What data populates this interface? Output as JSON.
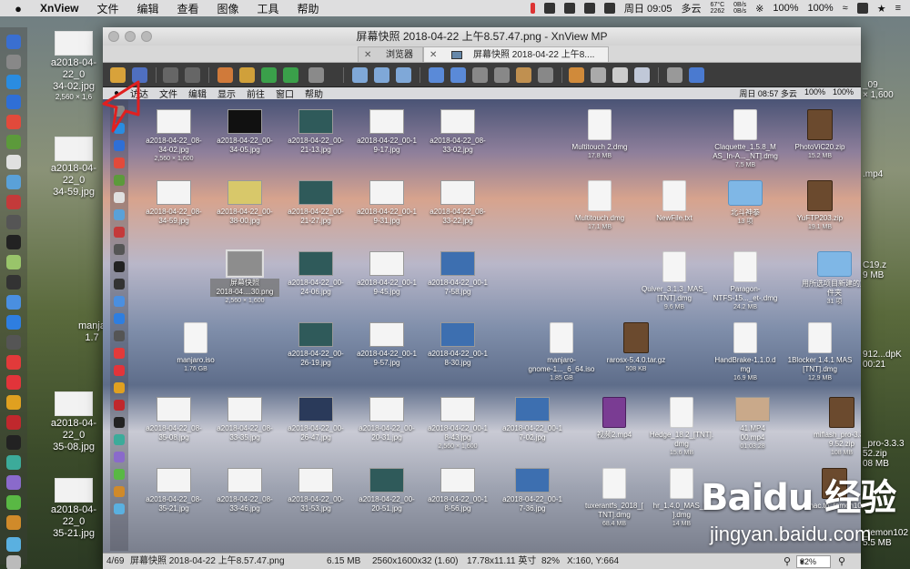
{
  "menubar": {
    "app_name": "XnView",
    "menus": [
      "文件",
      "编辑",
      "查看",
      "图像",
      "工具",
      "帮助"
    ],
    "status": {
      "temp": "67°C",
      "rpm": "2262",
      "net_up": "0B/s",
      "net_down": "0B/s",
      "clock": "周日 09:05",
      "weather": "多云",
      "battery": "100%",
      "battery2": "100%"
    }
  },
  "desktop": {
    "icons": [
      {
        "label": "a2018-04-22_0",
        "label2": "34-02.jpg",
        "sub": "2,560 × 1,6"
      },
      {
        "label": "a2018-04-22_0",
        "label2": "34-59.jpg",
        "sub": ""
      },
      {
        "label": "manja",
        "label2": "",
        "sub": "1.7"
      },
      {
        "label": "a2018-04-22_0",
        "label2": "35-08.jpg",
        "sub": ""
      },
      {
        "label": "a2018-04-22_0",
        "label2": "35-21.jpg",
        "sub": ""
      }
    ],
    "right_labels": [
      "_09_",
      "× 1,600",
      ".mp4",
      "C19.z",
      "9 MB",
      "912...dpK",
      "00:21",
      "_pro-3.3.3",
      "52.zip",
      "08 MB",
      "_temon102",
      "5.5 MB"
    ]
  },
  "window": {
    "title": "屏幕快照 2018-04-22 上午8.57.47.png - XnView MP",
    "tabs": [
      {
        "label": "浏览器"
      },
      {
        "label": "屏幕快照 2018-04-22 上午8...."
      }
    ]
  },
  "viewport": {
    "inner_menubar": {
      "menus": [
        "访达",
        "文件",
        "编辑",
        "显示",
        "前往",
        "窗口",
        "帮助"
      ],
      "status": "周日 08:57  多云",
      "battery": "100%",
      "battery2": "100%"
    },
    "files": [
      {
        "name": "a2018-04-22_08-",
        "name2": "34-02.jpg",
        "sub": "2,560 × 1,600",
        "kind": "img-white"
      },
      {
        "name": "a2018-04-22_00-",
        "name2": "34-05.jpg",
        "sub": "",
        "kind": "img-black"
      },
      {
        "name": "a2018-04-22_00-",
        "name2": "21-13.jpg",
        "sub": "",
        "kind": "img-teal"
      },
      {
        "name": "a2018-04-22_00-1",
        "name2": "9-17.jpg",
        "sub": "",
        "kind": "img-white"
      },
      {
        "name": "a2018-04-22_08-",
        "name2": "33-02.jpg",
        "sub": "",
        "kind": "img-white"
      },
      {
        "name": "Multitouch 2.dmg",
        "name2": "",
        "sub": "17.8 MB",
        "kind": "doc"
      },
      {
        "name": "Claquette_1.5.8_M",
        "name2": "AS_In-A..._NT].dmg",
        "sub": "7.5 MB",
        "kind": "doc"
      },
      {
        "name": "PhotoViC20.zip",
        "name2": "",
        "sub": "15.2 MB",
        "kind": "zip"
      },
      {
        "name": "a2018-04-22_08-",
        "name2": "34-59.jpg",
        "sub": "",
        "kind": "img-white"
      },
      {
        "name": "a2018-04-22_00-",
        "name2": "38-00.jpg",
        "sub": "",
        "kind": "img-yellow"
      },
      {
        "name": "a2018-04-22_00-",
        "name2": "21-27.jpg",
        "sub": "",
        "kind": "img-teal"
      },
      {
        "name": "a2018-04-22_00-1",
        "name2": "9-31.jpg",
        "sub": "",
        "kind": "img-white"
      },
      {
        "name": "a2018-04-22_08-",
        "name2": "33-22.jpg",
        "sub": "",
        "kind": "img-white"
      },
      {
        "name": "Multitouch.dmg",
        "name2": "",
        "sub": "17.1 MB",
        "kind": "doc"
      },
      {
        "name": "NewFile.txt",
        "name2": "",
        "sub": "",
        "kind": "doc"
      },
      {
        "name": "北斗神拳",
        "name2": "",
        "sub": "13 项",
        "kind": "folder"
      },
      {
        "name": "YuFTP203.zip",
        "name2": "",
        "sub": "19.1 MB",
        "kind": "zip"
      },
      {
        "name": "b.mp4",
        "name2": "",
        "sub": "",
        "kind": "mp4"
      },
      {
        "name": "屏幕快照",
        "name2": "2018-04....30.png",
        "sub": "2,560 × 1,600",
        "kind": "img-selected"
      },
      {
        "name": "a2018-04-22_00-",
        "name2": "24-06.jpg",
        "sub": "",
        "kind": "img-teal"
      },
      {
        "name": "a2018-04-22_00-1",
        "name2": "9-45.jpg",
        "sub": "",
        "kind": "img-white"
      },
      {
        "name": "a2018-04-22_00-1",
        "name2": "7-58.jpg",
        "sub": "",
        "kind": "img-blue"
      },
      {
        "name": "Quiver_3.1.3_MAS_",
        "name2": "[TNT].dmg",
        "sub": "9.6 MB",
        "kind": "doc"
      },
      {
        "name": "Paragon-",
        "name2": "NTFS-15..._et-.dmg",
        "sub": "24.2 MB",
        "kind": "doc"
      },
      {
        "name": "用所选项目新建的文",
        "name2": "件夹",
        "sub": "31 项",
        "kind": "folder"
      },
      {
        "name": "LauC19.zip",
        "name2": "",
        "sub": "9.9 MB",
        "kind": "zip"
      },
      {
        "name": "manjaro.iso",
        "name2": "",
        "sub": "1.76 GB",
        "kind": "doc"
      },
      {
        "name": "a2018-04-22_00-",
        "name2": "26-19.jpg",
        "sub": "",
        "kind": "img-teal"
      },
      {
        "name": "a2018-04-22_00-1",
        "name2": "9-57.jpg",
        "sub": "",
        "kind": "img-white"
      },
      {
        "name": "a2018-04-22_00-1",
        "name2": "8-30.jpg",
        "sub": "",
        "kind": "img-blue"
      },
      {
        "name": "manjaro-",
        "name2": "gnome-1..._6_64.iso",
        "sub": "1.85 GB",
        "kind": "doc"
      },
      {
        "name": "rarosx-5.4.0.tar.gz",
        "name2": "",
        "sub": "508 KB",
        "kind": "zip"
      },
      {
        "name": "HandBrake-1.1.0.d",
        "name2": "mg",
        "sub": "16.9 MB",
        "kind": "doc"
      },
      {
        "name": "1Blocker 1.4.1 MAS",
        "name2": "[TNT].dmg",
        "sub": "12.9 MB",
        "kind": "doc"
      },
      {
        "name": "x2M...PII912...dpK",
        "name2": "",
        "sub": "00:21",
        "kind": "zip"
      },
      {
        "name": "a2018-04-22_08-",
        "name2": "35-08.jpg",
        "sub": "",
        "kind": "img-white"
      },
      {
        "name": "a2018-04-22_08-",
        "name2": "33-35.jpg",
        "sub": "",
        "kind": "img-white"
      },
      {
        "name": "a2018-04-22_00-",
        "name2": "26-47.jpg",
        "sub": "",
        "kind": "img-dark"
      },
      {
        "name": "a2018-04-22_00-",
        "name2": "20-31.jpg",
        "sub": "",
        "kind": "img-white"
      },
      {
        "name": "a2018-04-22_00-1",
        "name2": "8-43.jpg",
        "sub": "2,560 × 1,600",
        "kind": "img-white"
      },
      {
        "name": "a2018-04-22_00-1",
        "name2": "7-02.jpg",
        "sub": "",
        "kind": "img-blue"
      },
      {
        "name": "视频2.mp4",
        "name2": "",
        "sub": "",
        "kind": "mp4"
      },
      {
        "name": "Hedge_18.2_[TNT].",
        "name2": "dmg",
        "sub": "15.6 MB",
        "kind": "doc"
      },
      {
        "name": "41.MP4",
        "name2": "00.mp4",
        "sub": "01:03:28",
        "kind": "img-photo"
      },
      {
        "name": "miflash_pro-3.3.3",
        "name2": "9.52.zip",
        "sub": "108 MB",
        "kind": "zip"
      },
      {
        "name": "a2018-04-22_08-",
        "name2": "35-21.jpg",
        "sub": "",
        "kind": "img-white"
      },
      {
        "name": "a2018-04-22_08-",
        "name2": "33-46.jpg",
        "sub": "",
        "kind": "img-white"
      },
      {
        "name": "a2018-04-22_00-",
        "name2": "31-53.jpg",
        "sub": "",
        "kind": "img-white"
      },
      {
        "name": "a2018-04-22_00-",
        "name2": "20-51.jpg",
        "sub": "",
        "kind": "img-teal"
      },
      {
        "name": "a2018-04-22_00-1",
        "name2": "8-56.jpg",
        "sub": "",
        "kind": "img-white"
      },
      {
        "name": "a2018-04-22_00-1",
        "name2": "7-36.jpg",
        "sub": "",
        "kind": "img-blue"
      },
      {
        "name": "tuxerantfs_2018_[",
        "name2": "TNT].dmg",
        "sub": "68.4 MB",
        "kind": "doc"
      },
      {
        "name": "hr_1.4.0_MAS_[T",
        "name2": "].dmg",
        "sub": "14 MB",
        "kind": "doc"
      },
      {
        "name": "dmac.to_temon102",
        "name2": "",
        "sub": "",
        "kind": "zip"
      }
    ]
  },
  "statusbar": {
    "index": "4/69",
    "filename": "屏幕快照 2018-04-22 上午8.57.47.png",
    "filesize": "6.15 MB",
    "dimensions": "2560x1600x32 (1.60)",
    "print_size": "17.78x11.11 英寸",
    "zoom_pct": "82%",
    "coords": "X:160, Y:664",
    "zoom_box": "82%"
  },
  "watermark": {
    "brand": "Baidu 经验",
    "url": "jingyan.baidu.com"
  },
  "colors": {
    "annotation_arrow": "#e02020",
    "window_bg": "#3a3a3a",
    "toolbar_bg": "#3c3c3c"
  }
}
